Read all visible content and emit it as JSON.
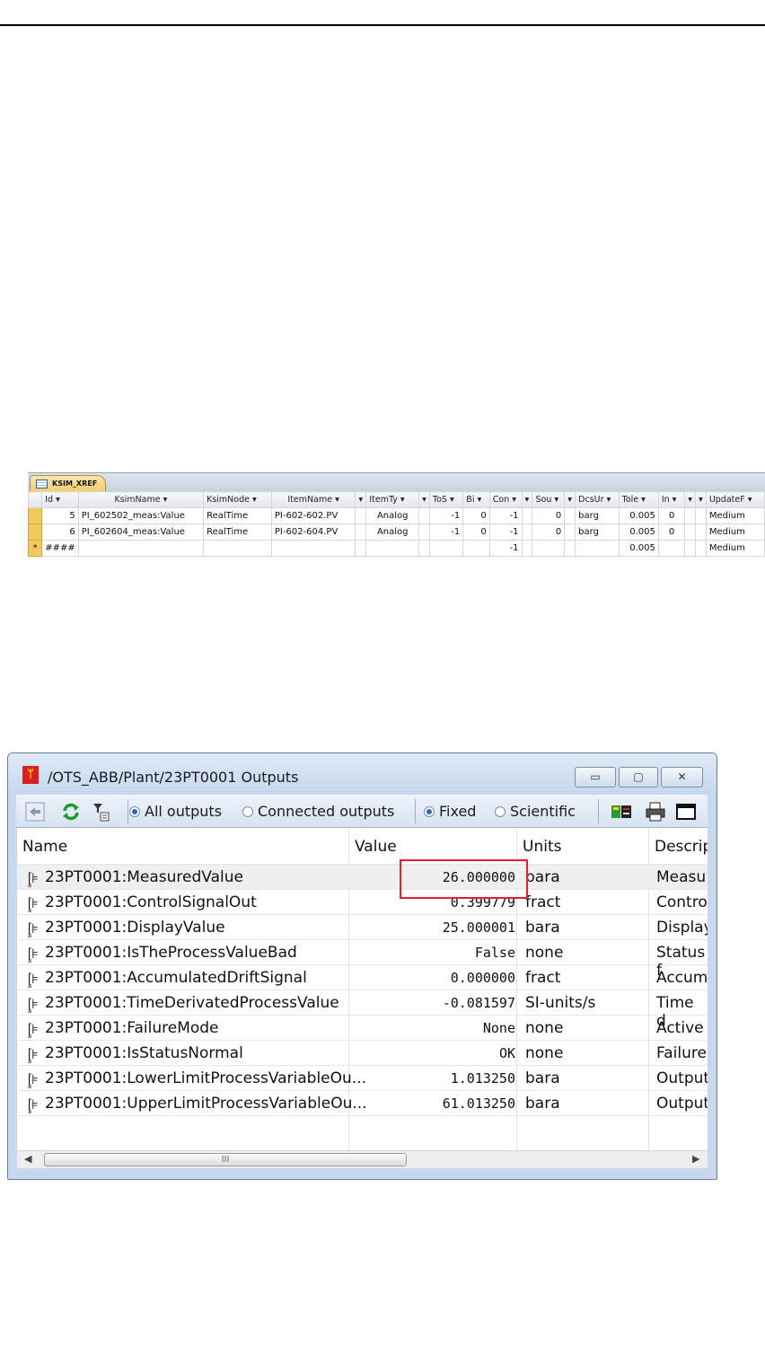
{
  "access": {
    "tab_label": "KSIM_XREF",
    "headers": [
      "Id ▾",
      "KsimName ▾",
      "KsimNode ▾",
      "ItemName ▾",
      "▾",
      "ItemTy ▾",
      "▾",
      "ToS ▾",
      "Bi ▾",
      "Con ▾",
      "▾",
      "Sou ▾",
      "▾",
      "DcsUr ▾",
      "Tole ▾",
      "In ▾",
      "▾",
      "▾",
      "UpdateF ▾"
    ],
    "rows": [
      [
        "5",
        "PI_602502_meas:Value",
        "RealTime",
        "PI-602-602.PV",
        "",
        "Analog",
        "",
        "-1",
        "0",
        "-1",
        "",
        "0",
        "",
        "barg",
        "0.005",
        "0",
        "",
        "",
        "Medium"
      ],
      [
        "6",
        "PI_602604_meas:Value",
        "RealTime",
        "PI-602-604.PV",
        "",
        "Analog",
        "",
        "-1",
        "0",
        "-1",
        "",
        "0",
        "",
        "barg",
        "0.005",
        "0",
        "",
        "",
        "Medium"
      ],
      [
        "####",
        "",
        "",
        "",
        "",
        "",
        "",
        "",
        "",
        "-1",
        "",
        "",
        "",
        "",
        "0.005",
        "",
        "",
        "",
        "Medium"
      ]
    ],
    "new_row_marker": "*"
  },
  "window": {
    "title": "/OTS_ABB/Plant/23PT0001 Outputs",
    "buttons": {
      "minimize": "▭",
      "maximize": "▢",
      "close": "✕"
    },
    "toolbar": {
      "all_outputs": "All outputs",
      "connected_outputs": "Connected outputs",
      "fixed": "Fixed",
      "scientific": "Scientific",
      "all_outputs_selected": true,
      "fixed_selected": true
    },
    "columns": {
      "name": "Name",
      "value": "Value",
      "units": "Units",
      "description": "Descrip"
    },
    "rows": [
      {
        "name": "23PT0001:MeasuredValue",
        "value": "26.000000",
        "units": "bara",
        "desc": "Measu"
      },
      {
        "name": "23PT0001:ControlSignalOut",
        "value": "0.399779",
        "units": "fract",
        "desc": "Contro"
      },
      {
        "name": "23PT0001:DisplayValue",
        "value": "25.000001",
        "units": "bara",
        "desc": "Display"
      },
      {
        "name": "23PT0001:IsTheProcessValueBad",
        "value": "False",
        "units": "none",
        "desc": "Status f"
      },
      {
        "name": "23PT0001:AccumulatedDriftSignal",
        "value": "0.000000",
        "units": "fract",
        "desc": "Accum"
      },
      {
        "name": "23PT0001:TimeDerivatedProcessValue",
        "value": "-0.081597",
        "units": "SI-units/s",
        "desc": "Time d"
      },
      {
        "name": "23PT0001:FailureMode",
        "value": "None",
        "units": "none",
        "desc": "Active"
      },
      {
        "name": "23PT0001:IsStatusNormal",
        "value": "OK",
        "units": "none",
        "desc": "Failure"
      },
      {
        "name": "23PT0001:LowerLimitProcessVariableOu...",
        "value": "1.013250",
        "units": "bara",
        "desc": "Output"
      },
      {
        "name": "23PT0001:UpperLimitProcessVariableOu...",
        "value": "61.013250",
        "units": "bara",
        "desc": "Output"
      }
    ],
    "scroll_grip": "III"
  }
}
